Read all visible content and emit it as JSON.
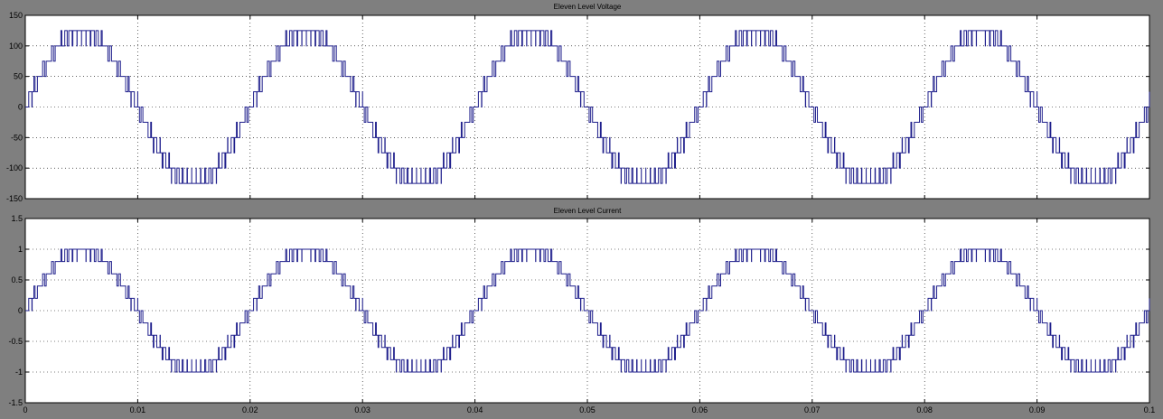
{
  "chart_data": [
    {
      "type": "line",
      "title": "Eleven Level Voltage",
      "xlabel": "",
      "ylabel": "",
      "xlim": [
        0,
        0.1
      ],
      "ylim": [
        -150,
        150
      ],
      "xticks": [
        0,
        0.01,
        0.02,
        0.03,
        0.04,
        0.05,
        0.06,
        0.07,
        0.08,
        0.09,
        0.1
      ],
      "yticks": [
        -150,
        -100,
        -50,
        0,
        50,
        100,
        150
      ],
      "grid": true,
      "color": "#1f1f8c",
      "series": [
        {
          "frequency_hz": 50,
          "levels": [
            -125,
            -100,
            -75,
            -50,
            -25,
            0,
            25,
            50,
            75,
            100,
            125
          ],
          "peak": 125,
          "description": "staircase sine with PWM switching between adjacent levels"
        }
      ]
    },
    {
      "type": "line",
      "title": "Eleven Level Current",
      "xlabel": "",
      "ylabel": "",
      "xlim": [
        0,
        0.1
      ],
      "ylim": [
        -1.5,
        1.5
      ],
      "xticks": [
        0,
        0.01,
        0.02,
        0.03,
        0.04,
        0.05,
        0.06,
        0.07,
        0.08,
        0.09,
        0.1
      ],
      "yticks": [
        -1.5,
        -1,
        -0.5,
        0,
        0.5,
        1,
        1.5
      ],
      "grid": true,
      "color": "#1f1f8c",
      "series": [
        {
          "frequency_hz": 50,
          "levels": [
            -1,
            -0.8,
            -0.6,
            -0.4,
            -0.2,
            0,
            0.2,
            0.4,
            0.6,
            0.8,
            1
          ],
          "peak": 1,
          "description": "staircase sine with PWM switching between adjacent levels"
        }
      ]
    }
  ]
}
